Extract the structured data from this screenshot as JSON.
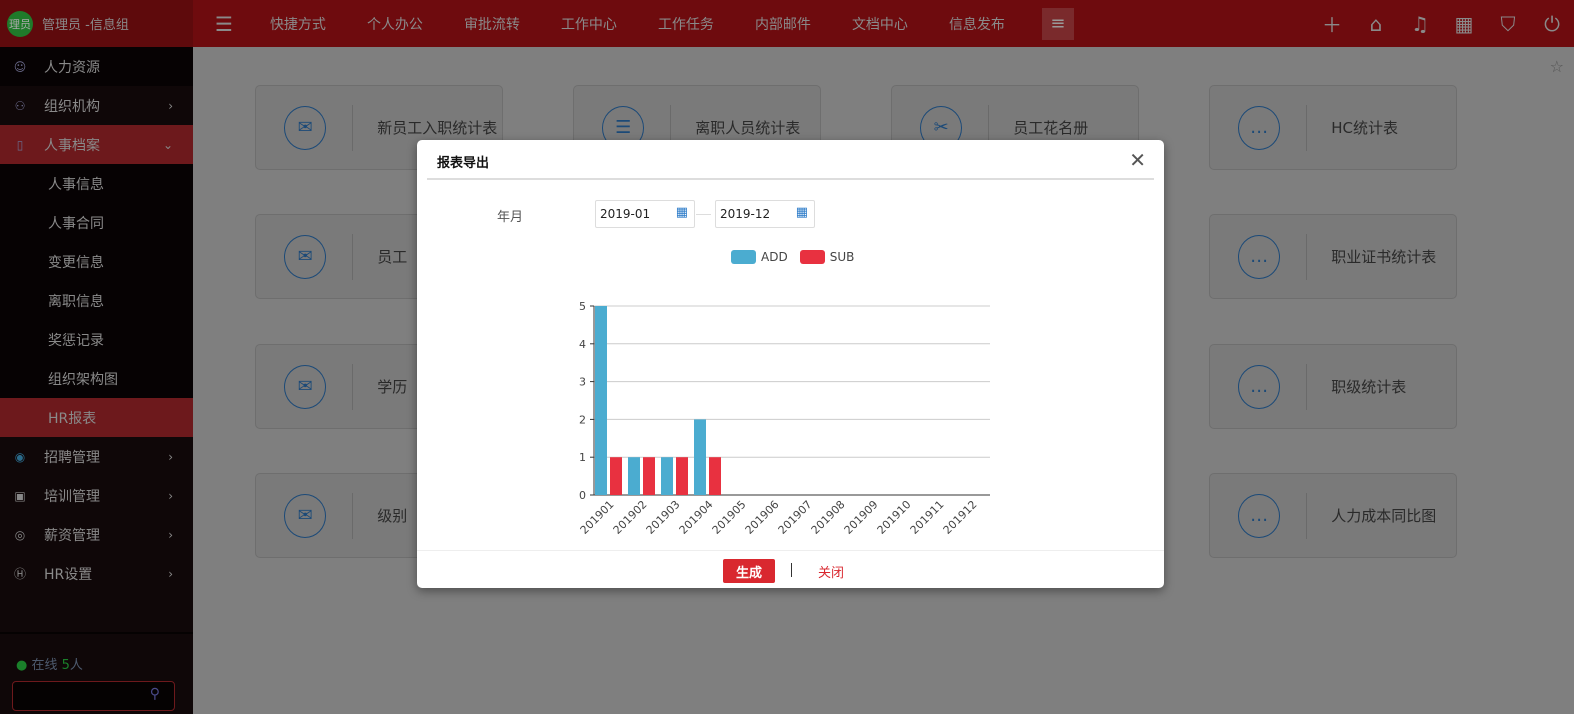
{
  "brand": {
    "avatar": "理员",
    "user": "管理员 -信息组"
  },
  "sidebar": {
    "items": [
      {
        "label": "人力资源",
        "icon": "user-list-icon"
      },
      {
        "label": "组织机构",
        "icon": "org-icon"
      },
      {
        "label": "人事档案",
        "icon": "file-icon"
      },
      {
        "label": "人事信息"
      },
      {
        "label": "人事合同"
      },
      {
        "label": "变更信息"
      },
      {
        "label": "离职信息"
      },
      {
        "label": "奖惩记录"
      },
      {
        "label": "组织架构图"
      },
      {
        "label": "HR报表"
      },
      {
        "label": "招聘管理",
        "icon": "recruit-icon"
      },
      {
        "label": "培训管理",
        "icon": "training-icon"
      },
      {
        "label": "薪资管理",
        "icon": "salary-icon"
      },
      {
        "label": "HR设置",
        "icon": "hr-icon"
      }
    ],
    "online_label": "在线",
    "online_count": "5",
    "online_unit": "人"
  },
  "topnav": {
    "items": [
      "快捷方式",
      "个人办公",
      "审批流转",
      "工作中心",
      "工作任务",
      "内部邮件",
      "文档中心",
      "信息发布"
    ]
  },
  "cards": [
    {
      "label": "新员工入职统计表",
      "icon": "mail-doc-icon"
    },
    {
      "label": "离职人员统计表",
      "icon": "list-icon"
    },
    {
      "label": "员工花名册",
      "icon": "tools-icon"
    },
    {
      "label": "HC统计表",
      "icon": "chat-icon"
    },
    {
      "label": "员工",
      "icon": "mail-doc-icon"
    },
    {
      "label": "",
      "icon": ""
    },
    {
      "label": "",
      "icon": ""
    },
    {
      "label": "职业证书统计表",
      "icon": "chat-icon"
    },
    {
      "label": "学历",
      "icon": "mail-doc-icon"
    },
    {
      "label": "",
      "icon": ""
    },
    {
      "label": "",
      "icon": ""
    },
    {
      "label": "职级统计表",
      "icon": "chat-icon"
    },
    {
      "label": "级别",
      "icon": "mail-doc-icon"
    },
    {
      "label": "",
      "icon": ""
    },
    {
      "label": "",
      "icon": ""
    },
    {
      "label": "人力成本同比图",
      "icon": "chat-icon"
    }
  ],
  "modal": {
    "title": "报表导出",
    "field_label": "年月",
    "start": "2019-01",
    "end": "2019-12",
    "generate": "生成",
    "close": "关闭"
  },
  "chart_data": {
    "type": "bar",
    "categories": [
      "201901",
      "201902",
      "201903",
      "201904",
      "201905",
      "201906",
      "201907",
      "201908",
      "201909",
      "201910",
      "201911",
      "201912"
    ],
    "series": [
      {
        "name": "ADD",
        "color": "#4bacd0",
        "values": [
          5,
          1,
          1,
          2,
          0,
          0,
          0,
          0,
          0,
          0,
          0,
          0
        ]
      },
      {
        "name": "SUB",
        "color": "#e83140",
        "values": [
          1,
          1,
          1,
          1,
          0,
          0,
          0,
          0,
          0,
          0,
          0,
          0
        ]
      }
    ],
    "ylim": [
      0,
      5
    ],
    "yticks": [
      0,
      1,
      2,
      3,
      4,
      5
    ],
    "grid": true,
    "legend": "top"
  }
}
